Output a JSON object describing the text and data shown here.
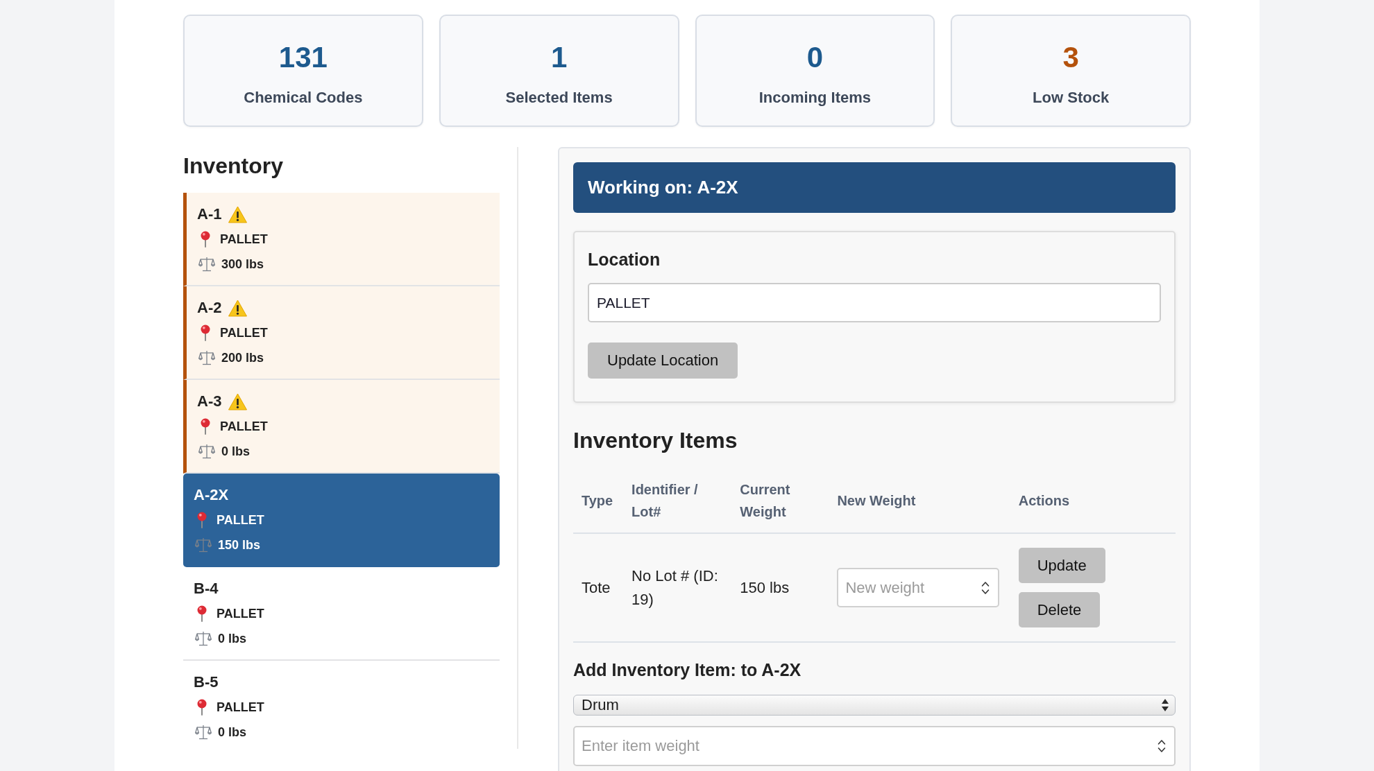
{
  "stats": [
    {
      "value": "131",
      "label": "Chemical Codes",
      "color": "#1d5a8e"
    },
    {
      "value": "1",
      "label": "Selected Items",
      "color": "#1d5a8e"
    },
    {
      "value": "0",
      "label": "Incoming Items",
      "color": "#1d5a8e"
    },
    {
      "value": "3",
      "label": "Low Stock",
      "color": "#b4520c"
    }
  ],
  "inventory": {
    "title": "Inventory",
    "items": [
      {
        "name": "A-1",
        "low_stock": true,
        "selected": false,
        "location": "PALLET",
        "weight": "300 lbs"
      },
      {
        "name": "A-2",
        "low_stock": true,
        "selected": false,
        "location": "PALLET",
        "weight": "200 lbs"
      },
      {
        "name": "A-3",
        "low_stock": true,
        "selected": false,
        "location": "PALLET",
        "weight": "0 lbs"
      },
      {
        "name": "A-2X",
        "low_stock": false,
        "selected": true,
        "location": "PALLET",
        "weight": "150 lbs"
      },
      {
        "name": "B-4",
        "low_stock": false,
        "selected": false,
        "location": "PALLET",
        "weight": "0 lbs"
      },
      {
        "name": "B-5",
        "low_stock": false,
        "selected": false,
        "location": "PALLET",
        "weight": "0 lbs"
      }
    ]
  },
  "panel": {
    "header": "Working on: A-2X",
    "location": {
      "title": "Location",
      "value": "PALLET",
      "button": "Update Location"
    },
    "items": {
      "title": "Inventory Items",
      "columns": [
        "Type",
        "Identifier / Lot#",
        "Current Weight",
        "New Weight",
        "Actions"
      ],
      "rows": [
        {
          "type": "Tote",
          "identifier": "No Lot # (ID: 19)",
          "current_weight": "150 lbs",
          "new_weight": {
            "placeholder": "New weight"
          },
          "actions": [
            "Update",
            "Delete"
          ]
        }
      ]
    },
    "add_item": {
      "title": "Add Inventory Item: to A-2X",
      "type_select": {
        "value": "Drum"
      },
      "weight": {
        "placeholder": "Enter item weight"
      }
    }
  }
}
